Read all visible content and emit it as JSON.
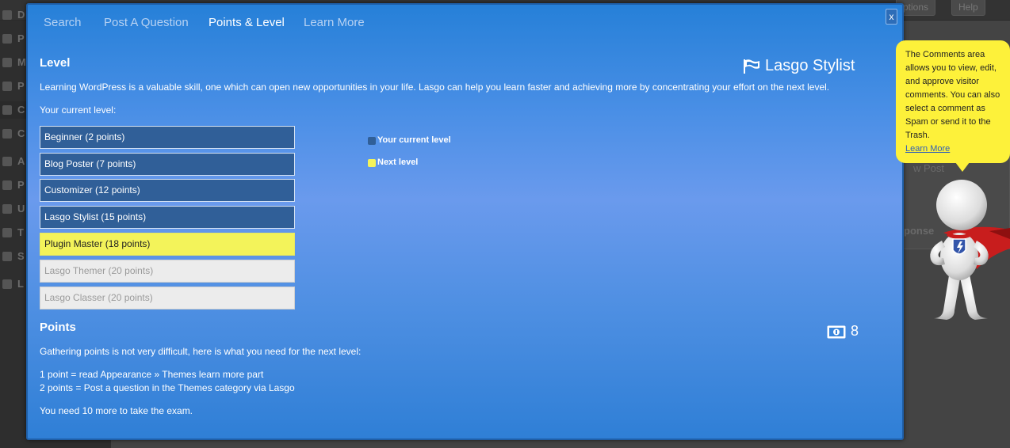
{
  "background": {
    "topbar_buttons": [
      "ptions",
      "Help"
    ],
    "sidebar_letters": [
      "D",
      "P",
      "M",
      "P",
      "C",
      "C",
      "A",
      "P",
      "U",
      "T",
      "S",
      "L"
    ],
    "panel_texts": [
      "w Post",
      "ponse"
    ]
  },
  "modal": {
    "close_label": "x",
    "nav": {
      "tabs": [
        "Search",
        "Post A Question",
        "Points & Level",
        "Learn More"
      ],
      "active": "Points & Level"
    },
    "level": {
      "title": "Level",
      "current_level_name": "Lasgo Stylist",
      "intro": "Learning WordPress is a valuable skill, one which can open new opportunities in your life. Lasgo can help you learn faster and achieving more by concentrating your effort on the next level.",
      "current_label": "Your current level:",
      "levels": [
        {
          "label": "Beginner (2 points)",
          "state": "current"
        },
        {
          "label": "Blog Poster (7 points)",
          "state": "current"
        },
        {
          "label": "Customizer (12 points)",
          "state": "current"
        },
        {
          "label": "Lasgo Stylist (15 points)",
          "state": "current"
        },
        {
          "label": "Plugin Master (18 points)",
          "state": "next"
        },
        {
          "label": "Lasgo Themer (20 points)",
          "state": "future"
        },
        {
          "label": "Lasgo Classer (20 points)",
          "state": "future"
        }
      ],
      "legend": {
        "current": "Your current level",
        "next": "Next level"
      }
    },
    "points": {
      "title": "Points",
      "value": "8",
      "intro": "Gathering points is not very difficult, here is what you need for the next level:",
      "rules": [
        "1 point = read Appearance » Themes learn more part",
        "2 points = Post a question in the Themes category via Lasgo"
      ],
      "exam_text": "You need 10 more to take the exam."
    }
  },
  "tooltip": {
    "text": "The Comments area allows you to view, edit, and approve visitor comments. You can also select a comment as Spam or send it to the Trash.",
    "link": "Learn More"
  },
  "colors": {
    "current_level": "#305f98",
    "next_level": "#f3f35a",
    "future_level": "#ececec",
    "tooltip_bg": "#fdf13a"
  }
}
